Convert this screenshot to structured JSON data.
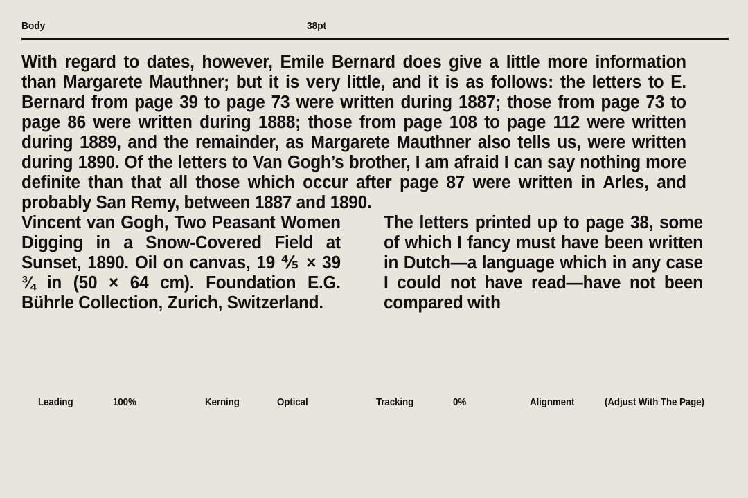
{
  "header": {
    "section_label": "Body",
    "size_label": "38pt"
  },
  "body": {
    "paragraph": "With regard to dates, however, Emile Bernard does give a little more information than Margarete Mauthner; but it is very little, and it is as follows: the letters to E. Bernard from page 39 to page 73 were written during 1887; those from page 73 to page 86 were written during 1888; those from page 108 to page 112 were written during 1889, and the remainder, as Margarete Mauthner also tells us, were written during 1890. Of the letters to Van Gogh’s brother, I am afraid I can say nothing more definite than that all those which occur after page 87 were written in Arles, and probably San Remy, between 1887 and 1890."
  },
  "columns": {
    "left": {
      "caption": "Vincent van Gogh, Two Peasant Women Digging in a Snow-Covered Field at Sunset, 1890. Oil on canvas, 19 ⅘ × 39 ¾ in (50 × 64 cm). Foundation E.G. Bührle Collection, Zurich, Switzerland."
    },
    "right": {
      "caption": "The letters printed up to page 38, some of which I fancy must have been written in Dutch—a language which in any case I could not have read—have not been compared with"
    }
  },
  "settings": {
    "leading_label": "Leading",
    "leading_value": "100%",
    "kerning_label": "Kerning",
    "kerning_value": "Optical",
    "tracking_label": "Tracking",
    "tracking_value": "0%",
    "alignment_label": "Alignment",
    "alignment_value": "(Adjust With The Page)"
  },
  "colors": {
    "background": "#e8e6dc",
    "text": "#111111",
    "rule": "#111111"
  }
}
